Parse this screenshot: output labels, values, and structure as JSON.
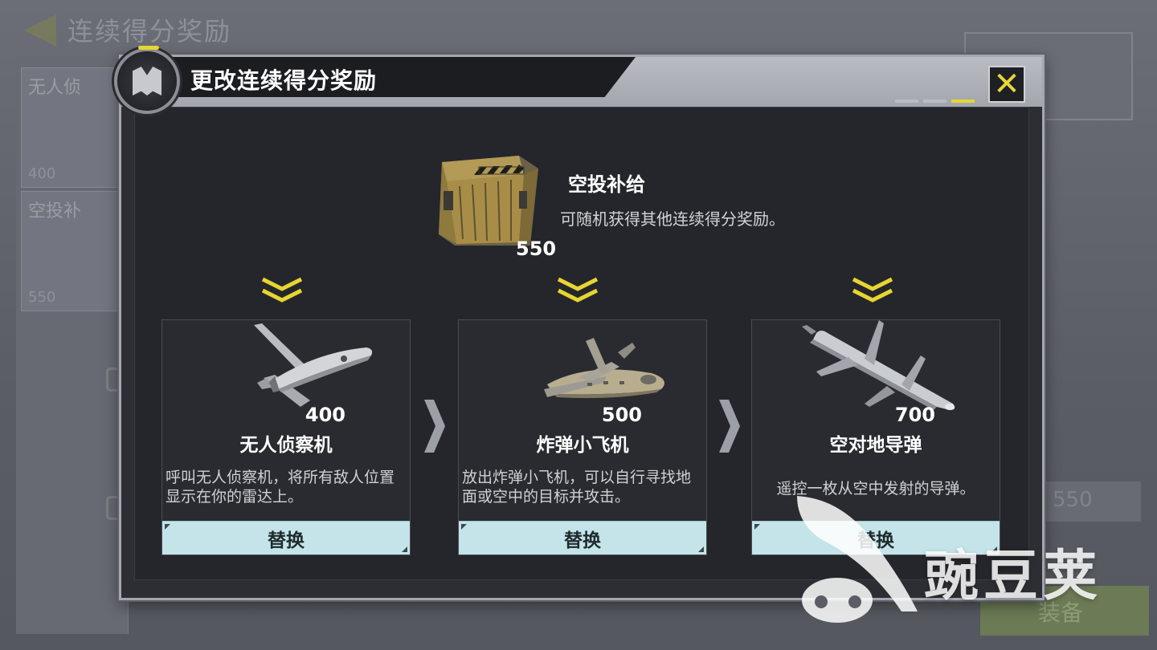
{
  "background": {
    "screen_title": "连续得分奖励",
    "equip_label": "装备",
    "cost_550": "550",
    "side_cards": [
      {
        "label": "无人侦",
        "cost": "400"
      },
      {
        "label": "空投补",
        "cost": "550"
      }
    ]
  },
  "dialog": {
    "title": "更改连续得分奖励",
    "close_icon": "close-icon",
    "page_indicator": {
      "count": 3,
      "active_index": 2
    }
  },
  "featured": {
    "name": "空投补给",
    "description": "可随机获得其他连续得分奖励。",
    "cost": "550",
    "icon": "supply-crate-icon"
  },
  "options": [
    {
      "name": "无人侦察机",
      "cost": "400",
      "description": "呼叫无人侦察机，将所有敌人位置显示在你的雷达上。",
      "button": "替换",
      "icon": "recon-drone-icon"
    },
    {
      "name": "炸弹小飞机",
      "cost": "500",
      "description": "放出炸弹小飞机，可以自行寻找地面或空中的目标并攻击。",
      "button": "替换",
      "icon": "bomb-drone-icon"
    },
    {
      "name": "空对地导弹",
      "cost": "700",
      "description": "遥控一枚从空中发射的导弹。",
      "button": "替换",
      "icon": "missile-icon"
    }
  ],
  "watermark": {
    "text": "豌豆荚"
  },
  "colors": {
    "accent_yellow": "#e7d531",
    "button_bg": "#c5e4e9",
    "dialog_bg": "#25262b"
  }
}
